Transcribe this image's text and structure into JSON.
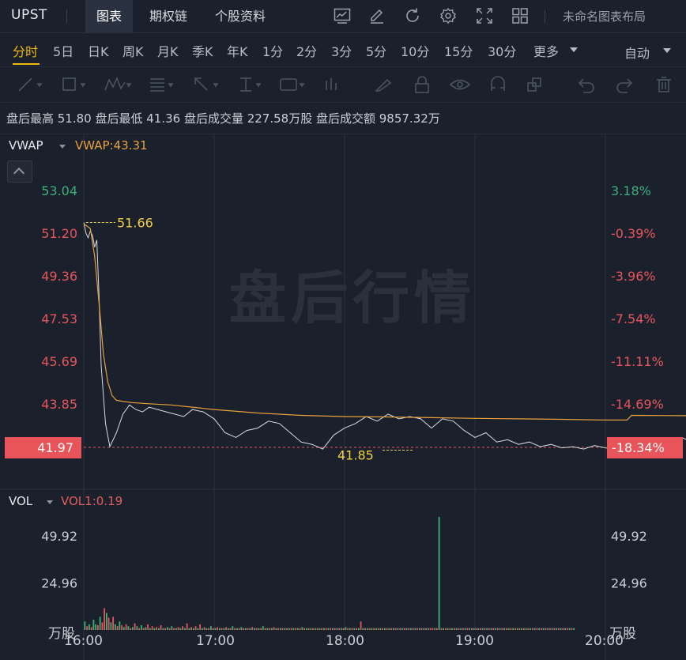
{
  "header": {
    "ticker": "UPST",
    "tabs": [
      "图表",
      "期权链",
      "个股资料"
    ],
    "layout_name": "未命名图表布局"
  },
  "periods": [
    "分时",
    "5日",
    "日K",
    "周K",
    "月K",
    "季K",
    "年K",
    "1分",
    "2分",
    "3分",
    "5分",
    "10分",
    "15分",
    "30分",
    "更多"
  ],
  "active_period": "分时",
  "auto_label": "自动",
  "toolbar_icons": [
    "trendline-icon",
    "rectangle-icon",
    "pattern-icon",
    "fib-icon",
    "arrow-icon",
    "text-cursor-icon",
    "text-label-icon",
    "bars-icon",
    "brush-icon",
    "lock-icon",
    "eye-icon",
    "magnet-icon",
    "layers-icon",
    "undo-icon",
    "redo-icon",
    "trash-icon"
  ],
  "stats": "盘后最高 51.80 盘后最低 41.36 盘后成交量 227.58万股 盘后成交额 9857.32万",
  "watermark": "盘后行情",
  "colors": {
    "up": "#3bb07a",
    "down": "#e9545a",
    "vwap": "#e8a13b",
    "price_line": "#d7dbe1"
  },
  "chart_data": [
    {
      "type": "line",
      "indicator": "VWAP",
      "indicator_value": "VWAP:43.31",
      "y_ticks_left": [
        "53.04",
        "51.20",
        "49.36",
        "47.53",
        "45.69",
        "43.85",
        "41.97"
      ],
      "y_ticks_right": [
        "3.18%",
        "-0.39%",
        "-3.96%",
        "-7.54%",
        "-11.11%",
        "-14.69%",
        "-18.34%"
      ],
      "ylim": [
        40.0,
        54.5
      ],
      "current_price": "41.97",
      "current_change": "-18.34%",
      "high_label": "51.66",
      "low_label": "41.85",
      "high_value": 51.66,
      "low_value": 41.85,
      "x_ticks": [
        "16:00",
        "17:00",
        "18:00",
        "19:00",
        "20:00"
      ],
      "series": [
        {
          "x": [
            0,
            1,
            2,
            3,
            4,
            5,
            6,
            7,
            8,
            10,
            12,
            15,
            18,
            21,
            24,
            27,
            30,
            34,
            38,
            42,
            46,
            50,
            55,
            60,
            65,
            70,
            75,
            80,
            85,
            90,
            95,
            100,
            105,
            110,
            115,
            120,
            125,
            130,
            135,
            140,
            145,
            150,
            155,
            160,
            165,
            170,
            175,
            180,
            185,
            190,
            195,
            200,
            205,
            210,
            215,
            220,
            225,
            230,
            235,
            240,
            245,
            250,
            255,
            260,
            265,
            270,
            275,
            280,
            285,
            290,
            295,
            300,
            305,
            310,
            315,
            320,
            325,
            330,
            335,
            340,
            345,
            350,
            355,
            360,
            365,
            370,
            375,
            380,
            385,
            390,
            395,
            400,
            405,
            410,
            415,
            420,
            425,
            430,
            435,
            440,
            445,
            450,
            455
          ],
          "values": [
            51.66,
            51.2,
            51.0,
            51.3,
            51.1,
            50.6,
            50.9,
            48.5,
            45.5,
            43.0,
            42.0,
            42.6,
            43.4,
            43.8,
            43.6,
            43.5,
            43.7,
            43.6,
            43.5,
            43.4,
            43.3,
            43.6,
            43.5,
            43.2,
            42.6,
            42.4,
            42.7,
            42.8,
            43.1,
            43.0,
            42.6,
            42.2,
            42.1,
            41.9,
            42.5,
            42.8,
            43.0,
            43.3,
            43.1,
            43.4,
            43.2,
            43.3,
            43.2,
            42.8,
            43.2,
            43.1,
            42.7,
            42.4,
            42.6,
            42.2,
            42.3,
            42.1,
            42.2,
            42.0,
            42.1,
            41.95,
            42.0,
            41.9,
            42.05,
            41.95,
            41.9,
            41.95,
            41.9,
            41.88,
            41.85,
            41.9,
            42.4,
            42.2,
            42.0,
            42.1,
            41.95,
            41.9,
            41.88,
            41.9,
            42.0,
            42.1,
            41.95,
            42.0,
            42.15,
            42.0,
            41.95,
            42.0,
            42.05,
            42.2,
            42.3,
            42.25,
            42.2,
            42.25,
            42.2,
            42.15,
            42.1,
            42.05,
            42.0,
            41.97,
            41.95,
            41.97,
            41.96,
            41.97,
            41.97,
            41.97,
            41.97,
            41.97,
            41.97
          ],
          "name": ""
        },
        {
          "x": [
            0,
            3,
            5,
            7,
            9,
            11,
            13,
            15,
            18,
            22,
            30,
            40,
            60,
            80,
            100,
            120,
            140,
            160,
            180,
            200,
            220,
            240,
            250,
            252,
            270,
            300,
            330,
            360,
            390,
            420,
            455
          ],
          "values": [
            51.6,
            51.4,
            50.2,
            48.2,
            46.0,
            44.8,
            44.2,
            44.0,
            43.95,
            43.9,
            43.85,
            43.8,
            43.6,
            43.45,
            43.35,
            43.3,
            43.28,
            43.25,
            43.22,
            43.2,
            43.18,
            43.15,
            43.15,
            43.35,
            43.34,
            43.33,
            43.32,
            43.31,
            43.31,
            43.31,
            43.31
          ],
          "name": "VWAP"
        }
      ]
    },
    {
      "type": "bar",
      "indicator": "VOL",
      "indicator_value": "VOL1:0.19",
      "y_ticks_left": [
        "49.92",
        "24.96"
      ],
      "y_ticks_right": [
        "49.92",
        "24.96"
      ],
      "unit": "万股",
      "ylim": [
        0,
        62
      ],
      "x": [
        1,
        3,
        5,
        7,
        9,
        11,
        13,
        15,
        17,
        19,
        21,
        23,
        25,
        27,
        29,
        31,
        33,
        35,
        37,
        39,
        41,
        43,
        45,
        47,
        49,
        51,
        53,
        55,
        57,
        59,
        61,
        63,
        65,
        67,
        69,
        71,
        73,
        75,
        77,
        79,
        81,
        83,
        85,
        87,
        89,
        91,
        93,
        95,
        97,
        99,
        101,
        103,
        105,
        107,
        109,
        111,
        113,
        115,
        117,
        119,
        121,
        123,
        125,
        127,
        129,
        131,
        133,
        135,
        137,
        139,
        141,
        143,
        145,
        147,
        149,
        151,
        153,
        155,
        157,
        159,
        161,
        163,
        165,
        167,
        169,
        171,
        173,
        175,
        177,
        179,
        181,
        183,
        185,
        187,
        189,
        191,
        193,
        195,
        197,
        199,
        201,
        203,
        205,
        207,
        209,
        211,
        213,
        215,
        217,
        219,
        221,
        223,
        225,
        227,
        229,
        231,
        233,
        235,
        237,
        239,
        241,
        243,
        245,
        247,
        249,
        251,
        253,
        255,
        257,
        259,
        261,
        263,
        265,
        267,
        269,
        271,
        273,
        275,
        277,
        279,
        281,
        283,
        285,
        287,
        289,
        291,
        293,
        295,
        297,
        299,
        301,
        303,
        305,
        307,
        309,
        311,
        313,
        315,
        317,
        319,
        321,
        323,
        325,
        327,
        329,
        331,
        333,
        335,
        337,
        339,
        341,
        343,
        345,
        347,
        349,
        351,
        353,
        355,
        357,
        359,
        361,
        363,
        365,
        367,
        369,
        371,
        373,
        375,
        377,
        379,
        381,
        383,
        385,
        387,
        389,
        391,
        393,
        395,
        397,
        399,
        401,
        403,
        405,
        407,
        409,
        411,
        413,
        415,
        417,
        419,
        421,
        423,
        425,
        427,
        429,
        431,
        433,
        435,
        437,
        439,
        441,
        443,
        445,
        447,
        449,
        451
      ],
      "values": [
        4.5,
        2.0,
        3.0,
        1.5,
        5.5,
        3.0,
        2.5,
        7.0,
        4.0,
        11.5,
        9.0,
        6.5,
        4.0,
        7.0,
        3.0,
        2.0,
        4.5,
        2.5,
        1.5,
        3.0,
        2.0,
        1.0,
        1.5,
        3.5,
        2.0,
        1.0,
        2.5,
        1.0,
        1.5,
        3.0,
        1.0,
        2.0,
        1.0,
        1.5,
        1.0,
        2.5,
        1.0,
        1.0,
        1.5,
        1.0,
        2.0,
        1.0,
        1.0,
        1.5,
        1.0,
        2.0,
        1.0,
        3.5,
        1.0,
        1.5,
        1.0,
        2.0,
        1.0,
        3.0,
        1.0,
        1.5,
        1.0,
        1.0,
        2.0,
        1.0,
        1.0,
        1.5,
        1.0,
        1.0,
        1.0,
        1.5,
        1.0,
        1.0,
        2.0,
        1.0,
        1.0,
        1.0,
        1.5,
        1.0,
        1.0,
        1.0,
        1.0,
        1.5,
        1.0,
        1.0,
        1.0,
        1.0,
        2.0,
        1.0,
        1.0,
        1.0,
        1.0,
        1.5,
        1.0,
        1.0,
        1.0,
        1.0,
        1.0,
        1.0,
        1.0,
        1.0,
        1.0,
        1.0,
        1.0,
        1.0,
        1.5,
        1.0,
        1.0,
        1.0,
        1.0,
        1.0,
        1.0,
        1.0,
        1.0,
        1.0,
        1.0,
        1.0,
        1.0,
        1.0,
        1.0,
        1.0,
        1.0,
        1.0,
        1.0,
        1.0,
        1.5,
        1.0,
        1.0,
        1.0,
        1.0,
        1.0,
        1.0,
        4.5,
        1.0,
        1.0,
        1.0,
        1.0,
        1.0,
        1.0,
        1.0,
        1.0,
        1.0,
        1.0,
        1.0,
        1.0,
        1.0,
        1.0,
        1.0,
        1.0,
        1.0,
        1.0,
        1.0,
        1.0,
        1.0,
        1.0,
        1.0,
        1.0,
        1.0,
        1.0,
        1.0,
        1.0,
        1.0,
        1.0,
        1.0,
        1.0,
        1.0,
        1.0,
        1.0,
        60.0,
        1.0,
        1.0,
        1.0,
        1.0,
        1.0,
        1.0,
        1.0,
        1.0,
        1.0,
        1.0,
        1.0,
        1.0,
        1.0,
        1.0,
        1.0,
        1.0,
        1.0,
        1.0,
        1.0,
        1.0,
        1.0,
        1.0,
        1.0,
        1.0,
        1.0,
        1.0,
        1.0,
        1.0,
        1.0,
        1.0,
        1.0,
        1.0,
        1.0,
        1.0,
        1.0,
        1.0,
        1.0,
        1.0,
        1.0,
        1.0,
        1.0,
        1.0,
        1.0,
        1.0,
        1.0,
        1.0,
        1.0,
        1.0,
        1.0,
        1.0,
        1.0,
        1.0,
        1.0,
        1.0,
        1.0,
        1.0,
        1.0,
        1.0,
        1.0,
        1.0,
        1.0,
        1.0
      ],
      "up": [
        true,
        false,
        true,
        false,
        true,
        true,
        false,
        true,
        false,
        false,
        true,
        false,
        true,
        false,
        true,
        false,
        true,
        false,
        true,
        false,
        true,
        false,
        true,
        false,
        true,
        false,
        true,
        false,
        true,
        false,
        true,
        false,
        true,
        false,
        true,
        false,
        true,
        false,
        true,
        false,
        true,
        false,
        true,
        false,
        true,
        false,
        true,
        false,
        true,
        false,
        true,
        false,
        true,
        false,
        true,
        false,
        true,
        false,
        true,
        false,
        true,
        false,
        true,
        false,
        true,
        false,
        true,
        false,
        true,
        false,
        true,
        false,
        true,
        false,
        true,
        false,
        true,
        false,
        true,
        false,
        true,
        false,
        true,
        false,
        true,
        false,
        true,
        false,
        true,
        false,
        true,
        false,
        true,
        false,
        true,
        false,
        true,
        false,
        true,
        false,
        true,
        false,
        true,
        false,
        true,
        false,
        true,
        false,
        true,
        false,
        true,
        false,
        true,
        false,
        true,
        false,
        true,
        false,
        true,
        false,
        true,
        false,
        true,
        false,
        true,
        false,
        true,
        false,
        true,
        false,
        true,
        false,
        true,
        false,
        true,
        false,
        true,
        false,
        true,
        false,
        true,
        false,
        true,
        false,
        true,
        false,
        true,
        false,
        true,
        false,
        true,
        false,
        true,
        false,
        true,
        false,
        true,
        false,
        true,
        false,
        false,
        true,
        false,
        true,
        false,
        true,
        false,
        true,
        false,
        true,
        false,
        true,
        false,
        true,
        false,
        true,
        false,
        true,
        false,
        true,
        false,
        true,
        false,
        true,
        false,
        true,
        false,
        true,
        false,
        true,
        false,
        true,
        false,
        true,
        false,
        true,
        false,
        true,
        false,
        true,
        false,
        true,
        false,
        true,
        false,
        true,
        false,
        true,
        false,
        true,
        false,
        true,
        false,
        true,
        false,
        true,
        false,
        true,
        false,
        true,
        false,
        true,
        false,
        true,
        false,
        true
      ]
    }
  ]
}
